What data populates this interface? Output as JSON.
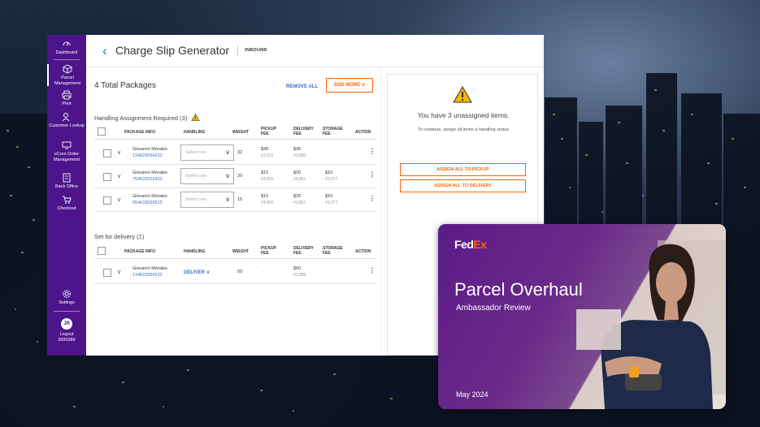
{
  "sidebar": {
    "items": [
      {
        "label": "Dashboard",
        "icon": "dashboard-icon"
      },
      {
        "label": "Parcel Management",
        "icon": "parcel-icon"
      },
      {
        "label": "Print",
        "icon": "printer-icon"
      },
      {
        "label": "Customer Lookup",
        "icon": "user-search-icon"
      },
      {
        "label": "eCom Order Management",
        "icon": "monitor-icon"
      },
      {
        "label": "Back Office",
        "icon": "building-icon"
      },
      {
        "label": "Checkout",
        "icon": "cart-icon"
      }
    ],
    "settings_label": "Settings",
    "avatar_initials": "JR",
    "logout_label": "Logout",
    "user_id": "3690389"
  },
  "header": {
    "title": "Charge Slip Generator",
    "mode": "INBOUND"
  },
  "summary": {
    "total": "4 Total Packages",
    "remove_all": "REMOVE ALL",
    "add_more": "ADD MORE"
  },
  "columns": {
    "package_info": "PACKAGE INFO",
    "handling": "HANDLING",
    "weight": "WEIGHT",
    "pickup_fee": "PICKUP FEE",
    "delivery_fee": "DELIVERY FEE",
    "storage_fee": "STORAGE FEE",
    "action": "ACTION"
  },
  "handling_section": {
    "title": "Handling Assignment Required (3)",
    "placeholder": "Select one",
    "rows": [
      {
        "name": "Giovanni Morales",
        "tracking": "134623054232",
        "weight": "32",
        "pickup": "$30",
        "pickup_code": "#1315",
        "delivery": "$36",
        "delivery_code": "#1389",
        "storage": "-",
        "storage_code": ""
      },
      {
        "name": "Giovanni Morales",
        "tracking": "754623022432",
        "weight": "20",
        "pickup": "$15",
        "pickup_code": "#1360",
        "delivery": "$20",
        "delivery_code": "#1381",
        "storage": "$10",
        "storage_code": "#1377"
      },
      {
        "name": "Giovanni Morales",
        "tracking": "654623028515",
        "weight": "15",
        "pickup": "$15",
        "pickup_code": "#1360",
        "delivery": "$20",
        "delivery_code": "#1381",
        "storage": "$10",
        "storage_code": "#1377"
      }
    ]
  },
  "delivery_section": {
    "title": "Set for delivery (1)",
    "rows": [
      {
        "name": "Giovanni Morales",
        "tracking": "134623054232",
        "handling": "DELIVER",
        "weight": "50",
        "pickup": "-",
        "delivery": "$50",
        "delivery_code": "#1389",
        "storage": "-"
      }
    ]
  },
  "notice": {
    "message": "You have 3 unassigned items.",
    "detail": "To continue, assign all items a handling status",
    "assign_pickup": "ASSIGN ALL TO PICKUP",
    "assign_delivery": "ASSIGN ALL TO DELIVERY"
  },
  "promo": {
    "logo_fed": "Fed",
    "logo_ex": "Ex",
    "title": "Parcel Overhaul",
    "subtitle": "Ambassador Review",
    "date": "May 2024"
  },
  "colors": {
    "brand_purple": "#4d148c",
    "brand_orange": "#ff6200",
    "link_blue": "#3c6fc4"
  }
}
